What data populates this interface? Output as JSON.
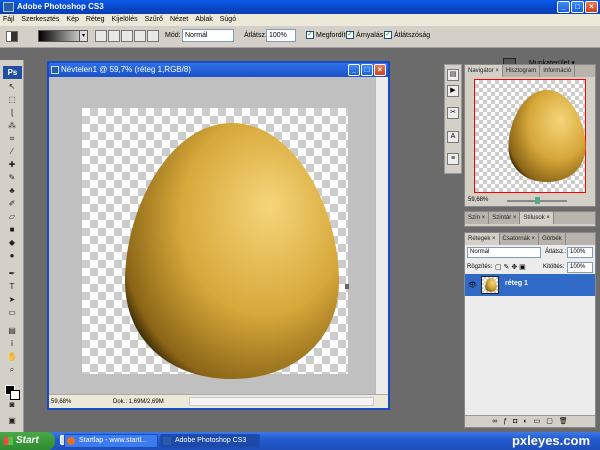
{
  "app": {
    "title": "Adobe Photoshop CS3",
    "ps_icon": "Ps"
  },
  "menu": [
    "Fájl",
    "Szerkesztés",
    "Kép",
    "Réteg",
    "Kijelölés",
    "Szűrő",
    "Nézet",
    "Ablak",
    "Súgó"
  ],
  "options": {
    "mode_label": "Mód:",
    "mode_value": "Normál",
    "opacity_label": "Átlátsz.:",
    "opacity_value": "100%",
    "reverse_label": "Megfordít",
    "dither_label": "Árnyalás",
    "transparency_label": "Átlátszóság",
    "workspace_label": "Munkaterület ▾"
  },
  "document": {
    "title": "Névtelen1 @ 59,7% (réteg 1,RGB/8)",
    "zoom": "59,68%",
    "doc_info": "Dok.: 1,69M/2,69M",
    "egg_colors": {
      "highlight": "#f5d67a",
      "mid": "#d7a83a",
      "shadow": "#3a2a08"
    }
  },
  "navigator": {
    "tabs": [
      "Navigátor ×",
      "Hisztogram",
      "Információ"
    ],
    "zoom": "59,68%"
  },
  "color_panel": {
    "tabs": [
      "Szín ×",
      "Színtár ×",
      "Stílusok ×"
    ]
  },
  "layers": {
    "tabs": [
      "Rétegek ×",
      "Csatornák ×",
      "Görbék"
    ],
    "blend_mode": "Normál",
    "opacity_label": "Átlátsz.:",
    "opacity_value": "100%",
    "lock_label": "Rögzítés:",
    "fill_label": "Kitöltés:",
    "fill_value": "100%",
    "items": [
      {
        "name": "réteg 1",
        "visible": true,
        "selected": true
      }
    ]
  },
  "taskbar": {
    "start": "Start",
    "tasks": [
      "Startlap - www.startl...",
      "Adobe Photoshop CS3"
    ]
  },
  "watermark": "pxleyes.com"
}
